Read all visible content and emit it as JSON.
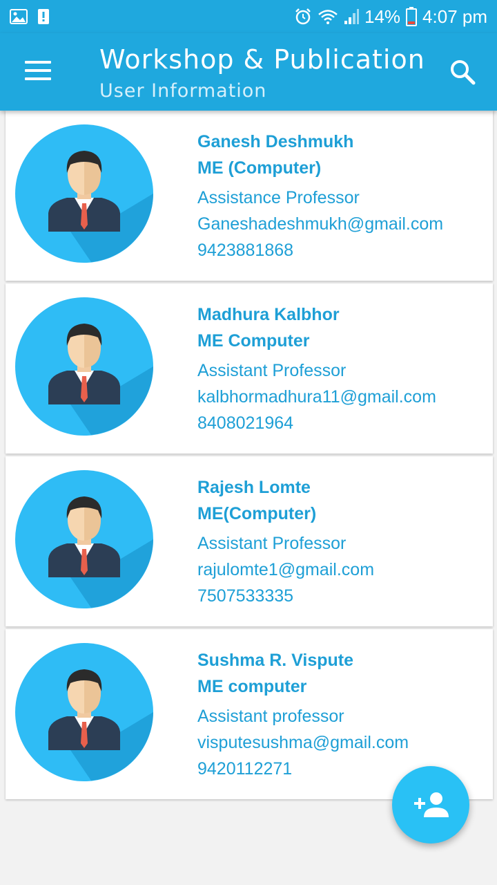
{
  "status_bar": {
    "battery_percent": "14%",
    "time": "4:07 pm",
    "icons": [
      "image-icon",
      "alert-icon",
      "alarm-icon",
      "wifi-icon",
      "signal-icon",
      "battery-icon"
    ]
  },
  "app_bar": {
    "title": "Workshop & Publication",
    "subtitle": "User Information",
    "icons": [
      "menu-icon",
      "search-icon"
    ]
  },
  "colors": {
    "primary": "#1fa8de",
    "accent": "#29c1f5",
    "text": "#1e9fd6"
  },
  "users": [
    {
      "name": "Ganesh Deshmukh",
      "degree": "ME (Computer)",
      "role": "Assistance Professor",
      "email": "Ganeshadeshmukh@gmail.com",
      "phone": "9423881868"
    },
    {
      "name": "Madhura Kalbhor",
      "degree": "ME Computer",
      "role": "Assistant Professor",
      "email": "kalbhormadhura11@gmail.com",
      "phone": "8408021964"
    },
    {
      "name": "Rajesh Lomte",
      "degree": "ME(Computer)",
      "role": "Assistant Professor",
      "email": "rajulomte1@gmail.com",
      "phone": "7507533335"
    },
    {
      "name": "Sushma R. Vispute",
      "degree": "ME computer",
      "role": "Assistant professor",
      "email": "visputesushma@gmail.com",
      "phone": "9420112271"
    }
  ],
  "fab": {
    "icon": "add-user-icon"
  }
}
